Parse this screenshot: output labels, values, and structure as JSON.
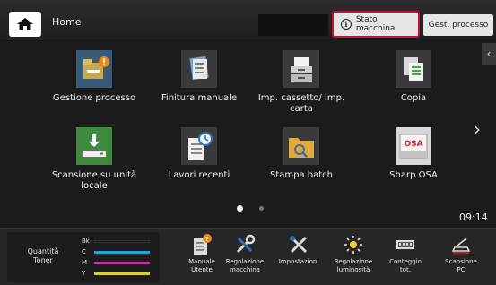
{
  "header": {
    "title": "Home",
    "status_button_label": "Stato macchina",
    "process_button_label": "Gest. processo"
  },
  "apps": [
    {
      "label": "Gestione processo",
      "icon": "job-management-icon"
    },
    {
      "label": "Finitura manuale",
      "icon": "manual-finishing-icon"
    },
    {
      "label": "Imp. cassetto/ Imp. carta",
      "icon": "tray-settings-icon"
    },
    {
      "label": "Copia",
      "icon": "copy-icon"
    },
    {
      "label": "Scansione su unità locale",
      "icon": "scan-to-local-icon"
    },
    {
      "label": "Lavori recenti",
      "icon": "recent-jobs-icon"
    },
    {
      "label": "Stampa batch",
      "icon": "batch-print-icon"
    },
    {
      "label": "Sharp OSA",
      "icon": "sharp-osa-icon"
    }
  ],
  "osa_text": "OSA",
  "pager": {
    "current": 1,
    "total": 2
  },
  "clock": "09:14",
  "toner": {
    "label": "Quantità Toner",
    "levels": [
      {
        "key": "Bk",
        "color": "#111111"
      },
      {
        "key": "C",
        "color": "#1aa6d8"
      },
      {
        "key": "M",
        "color": "#c0399a"
      },
      {
        "key": "Y",
        "color": "#d9cf34"
      }
    ]
  },
  "quick_actions": [
    {
      "label": "Manuale Utente",
      "icon": "user-manual-icon"
    },
    {
      "label": "Regolazione macchina",
      "icon": "machine-adjust-icon"
    },
    {
      "label": "Impostazioni",
      "icon": "settings-tools-icon"
    },
    {
      "label": "Regolazione luminosità",
      "icon": "brightness-icon"
    },
    {
      "label": "Conteggio tot.",
      "icon": "total-count-icon"
    },
    {
      "label": "Scansione PC",
      "icon": "scan-to-pc-icon"
    }
  ],
  "colors": {
    "accent_red": "#c8102e",
    "tile_bg": "#3a3a3a",
    "osa_red": "#d8232a"
  }
}
